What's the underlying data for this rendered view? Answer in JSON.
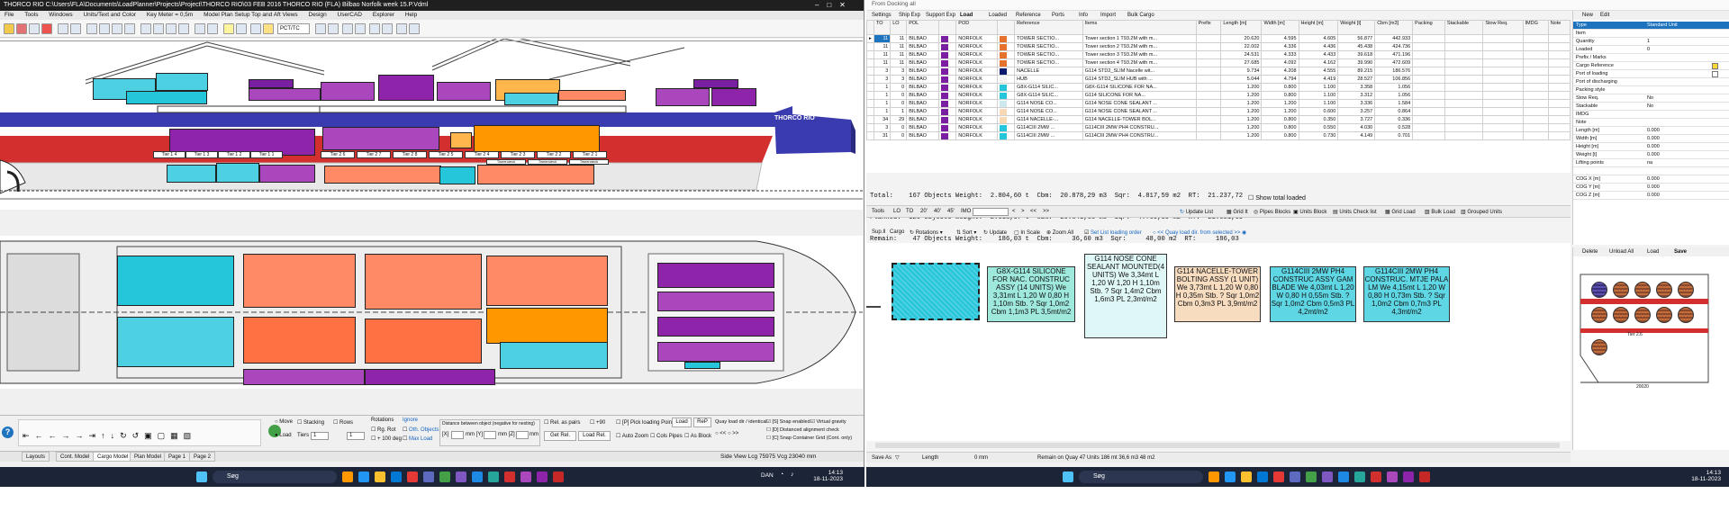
{
  "left_app": {
    "title": "THORCO RIO  C:\\Users\\FLA\\Documents\\LoadPlanner\\Projects\\Project\\THORCO RIO\\03 FEB 2016 THORCO RIO (FLA) Bilbao  Norfolk week 15.P.Vdml",
    "menu": [
      "File",
      "Tools",
      "Windows",
      "Units/Text and Color",
      "Key Meter = 0,5m",
      "Model Plan Setup Top and Aft Views",
      "Design",
      "UserCAD",
      "Explorer",
      "Help"
    ],
    "zoom_value": "PCT/TC",
    "ship_name": "THORCO RIO",
    "tiers_top": [
      "Tier 1 4",
      "Tier 1 3",
      "Tier 1 2",
      "Tier 1 1",
      "Tier 2 6",
      "Tier 2 7",
      "Tier 2 8",
      "Tier 2 5",
      "Tier 2 4",
      "Tier 2 3",
      "Tier 2 2",
      "Tier 2 1"
    ],
    "tweendeck_labels": [
      "Tweendeck",
      "Tweendeck",
      "Tweendeck"
    ],
    "controls": {
      "move": "Move",
      "load": "Load",
      "stacking": "Stacking",
      "rows": "Rows",
      "tiers_label": "Tiers",
      "tiers_val": "1",
      "rows_val": "1",
      "rotations": "Rotations",
      "rg_rot": "Rg. Rot",
      "r100": "+ 100 deg",
      "ignore": "Ignore",
      "oth_objects": "Oth. Objects",
      "max_load": "Max Load",
      "distance_label": "Distance between object (negative for nesting)",
      "dist_x": "[X]",
      "dist_y": "mm [Y]",
      "dist_z": "mm [Z]",
      "dist_unit": "mm",
      "rel_pairs": "Rel. as pairs",
      "plus90": "+90",
      "get_rel": "Get Rel.",
      "load_rel": "Load Rel.",
      "pick_loading_point": "[P] Pick loading Point",
      "load_btn": "Load",
      "rep_btn": "ReP",
      "auto_zoom": "Auto Zoom",
      "cols_pipes": "Cols Pipes",
      "as_block": "As Block",
      "quay_load": "Quay load dir / identical",
      "snap_enabled": "[S] Snap enabled",
      "virtual_gravity": "Virtual gravity",
      "distanced_alignment": "[D] Distanced alignment check",
      "snap_container": "[C] Snap Container Grid (Cont. only)"
    },
    "tabs": [
      "Layouts",
      "Cont. Model",
      "Cargo Model",
      "Plan Model",
      "Page 1",
      "Page 2"
    ],
    "status": "Side View Lcg 75975 Vcg 23040 mm"
  },
  "right_app": {
    "title": "From Docking all",
    "tabs": [
      "Settings",
      "Ship Exp",
      "Support Exp",
      "Load",
      "Loaded",
      "Reference",
      "Ports",
      "Info",
      "Import",
      "Bulk Cargo"
    ],
    "columns": [
      "TO",
      "LO",
      "POL",
      "",
      "POD",
      "",
      "Reference",
      "Items",
      "Prefix",
      "Length [m]",
      "Width [m]",
      "Height [m]",
      "Weight [t]",
      "Cbm [m3]",
      "Packing",
      "Stackable",
      "Stow Req.",
      "IMDG",
      "Note"
    ],
    "rows": [
      {
        "to": "11",
        "lo": "11",
        "pol": "BILBAO",
        "pod": "NORFOLK",
        "c2": "#e5732d",
        "ref": "TOWER SECTIO...",
        "items": "Tower section 1 T93.2M with m...",
        "len": "20.620",
        "wid": "4.595",
        "hgt": "4.605",
        "wgt": "56.877",
        "cbm": "442.933",
        "c1": "#7b1fa2"
      },
      {
        "to": "11",
        "lo": "11",
        "pol": "BILBAO",
        "pod": "NORFOLK",
        "c2": "#e5732d",
        "ref": "TOWER SECTIO...",
        "items": "Tower section 2 T93.2M with m...",
        "len": "22.002",
        "wid": "4.336",
        "hgt": "4.436",
        "wgt": "45.438",
        "cbm": "424.736",
        "c1": "#7b1fa2"
      },
      {
        "to": "11",
        "lo": "11",
        "pol": "BILBAO",
        "pod": "NORFOLK",
        "c2": "#e5732d",
        "ref": "TOWER SECTIO...",
        "items": "Tower section 3 T93.2M with m...",
        "len": "24.531",
        "wid": "4.333",
        "hgt": "4.433",
        "wgt": "39.618",
        "cbm": "471.196",
        "c1": "#7b1fa2"
      },
      {
        "to": "11",
        "lo": "11",
        "pol": "BILBAO",
        "pod": "NORFOLK",
        "c2": "#e5732d",
        "ref": "TOWER SECTIO...",
        "items": "Tower section 4 T93.2M with m...",
        "len": "27.685",
        "wid": "4.092",
        "hgt": "4.162",
        "wgt": "39.990",
        "cbm": "472.609",
        "c1": "#7b1fa2"
      },
      {
        "to": "3",
        "lo": "3",
        "pol": "BILBAO",
        "pod": "NORFOLK",
        "c2": "#0b1a6e",
        "ref": "NACELLE",
        "items": "G114 STD2_SLIM Nacelle wit...",
        "len": "9.734",
        "wid": "4.208",
        "hgt": "4.555",
        "wgt": "89.215",
        "cbm": "186.576",
        "c1": "#7b1fa2"
      },
      {
        "to": "3",
        "lo": "3",
        "pol": "BILBAO",
        "pod": "NORFOLK",
        "c2": "#f3f3f3",
        "ref": "HUB",
        "items": "G114 STD2_SLIM HUB with ...",
        "len": "5.044",
        "wid": "4.794",
        "hgt": "4.419",
        "wgt": "28.527",
        "cbm": "106.856",
        "c1": "#7b1fa2"
      },
      {
        "to": "1",
        "lo": "0",
        "pol": "BILBAO",
        "pod": "NORFOLK",
        "c2": "#26c6da",
        "ref": "G8X-G114 SILIC...",
        "items": "G8X-G114 SILICONE FOR NA...",
        "len": "1.200",
        "wid": "0.800",
        "hgt": "1.100",
        "wgt": "3.358",
        "cbm": "1.056",
        "c1": "#7b1fa2"
      },
      {
        "to": "1",
        "lo": "0",
        "pol": "BILBAO",
        "pod": "NORFOLK",
        "c2": "#26c6da",
        "ref": "G8X-G114 SILIC...",
        "items": "G114 SILICONE FOR NA...",
        "len": "1.200",
        "wid": "0.800",
        "hgt": "1.100",
        "wgt": "3.312",
        "cbm": "1.056",
        "c1": "#7b1fa2"
      },
      {
        "to": "1",
        "lo": "0",
        "pol": "BILBAO",
        "pod": "NORFOLK",
        "c2": "#cde9ee",
        "ref": "G114 NOSE CO...",
        "items": "G114 NOSE CONE SEALANT ...",
        "len": "1.200",
        "wid": "1.200",
        "hgt": "1.100",
        "wgt": "3.336",
        "cbm": "1.584",
        "c1": "#7b1fa2"
      },
      {
        "to": "1",
        "lo": "1",
        "pol": "BILBAO",
        "pod": "NORFOLK",
        "c2": "#f7d9b5",
        "ref": "G114 NOSE CO...",
        "items": "G114 NOSE CONE SEALANT ...",
        "len": "1.200",
        "wid": "1.200",
        "hgt": "0.600",
        "wgt": "3.257",
        "cbm": "0.864",
        "c1": "#7b1fa2"
      },
      {
        "to": "34",
        "lo": "29",
        "pol": "BILBAO",
        "pod": "NORFOLK",
        "c2": "#f7d9b5",
        "ref": "G114 NACELLE-...",
        "items": "G114 NACELLE-TOWER BOL...",
        "len": "1.200",
        "wid": "0.800",
        "hgt": "0.350",
        "wgt": "3.727",
        "cbm": "0.336",
        "c1": "#7b1fa2"
      },
      {
        "to": "3",
        "lo": "0",
        "pol": "BILBAO",
        "pod": "NORFOLK",
        "c2": "#26c6da",
        "ref": "G114CIII 2MW ...",
        "items": "G114CIII 2MW PH4 CONSTRU...",
        "len": "1.200",
        "wid": "0.800",
        "hgt": "0.550",
        "wgt": "4.030",
        "cbm": "0.528",
        "c1": "#7b1fa2"
      },
      {
        "to": "31",
        "lo": "0",
        "pol": "BILBAO",
        "pod": "NORFOLK",
        "c2": "#26c6da",
        "ref": "G114CIII 2MW ...",
        "items": "G114CIII 2MW PH4 CONSTRU...",
        "len": "1.200",
        "wid": "0.800",
        "hgt": "0.730",
        "wgt": "4.149",
        "cbm": "0.701",
        "c1": "#7b1fa2"
      }
    ],
    "totals": [
      "Total:    167 Objects Weight:  2.804,60 t  Cbm:  20.878,29 m3  Sqr:  4.817,59 m2  RT:  21.237,72",
      "Planned:  120 Objects Weight:  2.618,57 t  Cbm:  20.841,68 m3  Sqr:  4.769,59 m2  RT:  21.051,69",
      "Remain:    47 Objects Weight:    186,03 t  Cbm:     36,60 m3  Sqr:     48,00 m2  RT:     186,03"
    ],
    "show_total_loaded": "Show total loaded",
    "toolbar2": [
      "Tools",
      "LO",
      "TO",
      "20'",
      "40'",
      "45'",
      "IMO",
      "<",
      ">",
      "<<",
      ">>",
      "Update List",
      "Grid It",
      "Pipes Blocks",
      "Units Block",
      "Units Check list",
      "Grid Load",
      "Bulk Load",
      "Grouped Units"
    ],
    "toolbar3": [
      "Sup.Il",
      "Cargo",
      "Rotations",
      "Sort",
      "Update",
      "In Scale",
      "Zoom All",
      "Set List loading order",
      "<< Quay load dir. from selected >>"
    ],
    "cards": [
      {
        "text": "",
        "bg": "#4dd0e1"
      },
      {
        "text": "G8X-G114 SILICONE FOR NAC. CONSTRUC ASSY (14 UNITS) We 3,31mt L 1,20 W 0,80 H 1,10m Stb. ? Sqr 1,0m2 Cbm 1,1m3 PL 3,5mt/m2",
        "bg": "#9ee8dc"
      },
      {
        "text": "G114 NOSE CONE SEALANT MOUNTED(4 UNITS) We 3,34mt L 1,20 W 1,20 H 1,10m Stb. ? Sqr 1,4m2 Cbm 1,6m3 PL 2,3mt/m2",
        "bg": "#e0f7f7"
      },
      {
        "text": "G114 NACELLE-TOWER BOLTING ASSY (1 UNIT) We 3,73mt L 1,20 W 0,80 H 0,35m Stb. ? Sqr 1,0m2 Cbm 0,3m3 PL 3,9mt/m2",
        "bg": "#f7dcc0"
      },
      {
        "text": "G114CIII 2MW PH4 CONSTRUC ASSY GAM BLADE We 4,03mt L 1,20 W 0,80 H 0,55m Stb. ? Sqr 1,0m2 Cbm 0,5m3 PL 4,2mt/m2",
        "bg": "#5fd6e4"
      },
      {
        "text": "G114CIII 2MW PH4 CONSTRUC. MTJE PALA LM We 4,15mt L 1,20 W 0,80 H 0,73m Stb. ? Sqr 1,0m2 Cbm 0,7m3 PL 4,3mt/m2",
        "bg": "#5fd6e4"
      }
    ],
    "bottom_bar": {
      "save_as": "Save As",
      "length": "Length",
      "mm": "0 mm",
      "remain": "Remain on Quay 47 Units 186 mt 36,6 m3 48 m2"
    },
    "props_tabs": [
      "New",
      "Edit"
    ],
    "props": [
      {
        "k": "Type",
        "v": "Standard Unit"
      },
      {
        "k": "Item",
        "v": ""
      },
      {
        "k": "Quantity",
        "v": "1"
      },
      {
        "k": "Loaded",
        "v": "0"
      },
      {
        "k": "Prefix / Marks",
        "v": ""
      },
      {
        "k": "Cargo Reference",
        "v": ""
      },
      {
        "k": "Port of loading",
        "v": ""
      },
      {
        "k": "Port of discharging",
        "v": ""
      },
      {
        "k": "Packing style",
        "v": ""
      },
      {
        "k": "Stow Req.",
        "v": "No"
      },
      {
        "k": "Stackable",
        "v": "No"
      },
      {
        "k": "IMDG",
        "v": ""
      },
      {
        "k": "Note",
        "v": ""
      },
      {
        "k": "Length [m]",
        "v": "0.000"
      },
      {
        "k": "Width [m]",
        "v": "0.000"
      },
      {
        "k": "Height [m]",
        "v": "0.000"
      },
      {
        "k": "Weight [t]",
        "v": "0.000"
      },
      {
        "k": "Lifting points",
        "v": "na"
      },
      {
        "k": "",
        "v": ""
      },
      {
        "k": "COG X [m]",
        "v": "0.000"
      },
      {
        "k": "COG Y [m]",
        "v": "0.000"
      },
      {
        "k": "COG Z [m]",
        "v": "0.000"
      }
    ],
    "props_buttons": [
      "Delete",
      "Unload All",
      "Load",
      "Save"
    ],
    "mini_label": "Tier 2.6",
    "mini_bottom": "20020"
  },
  "taskbar_left": {
    "search": "Søg",
    "lang": "DAN",
    "time": "14:13",
    "date": "18-11-2023"
  },
  "taskbar_right": {
    "search": "Søg",
    "time": "14:13",
    "date": "18-11-2023"
  }
}
